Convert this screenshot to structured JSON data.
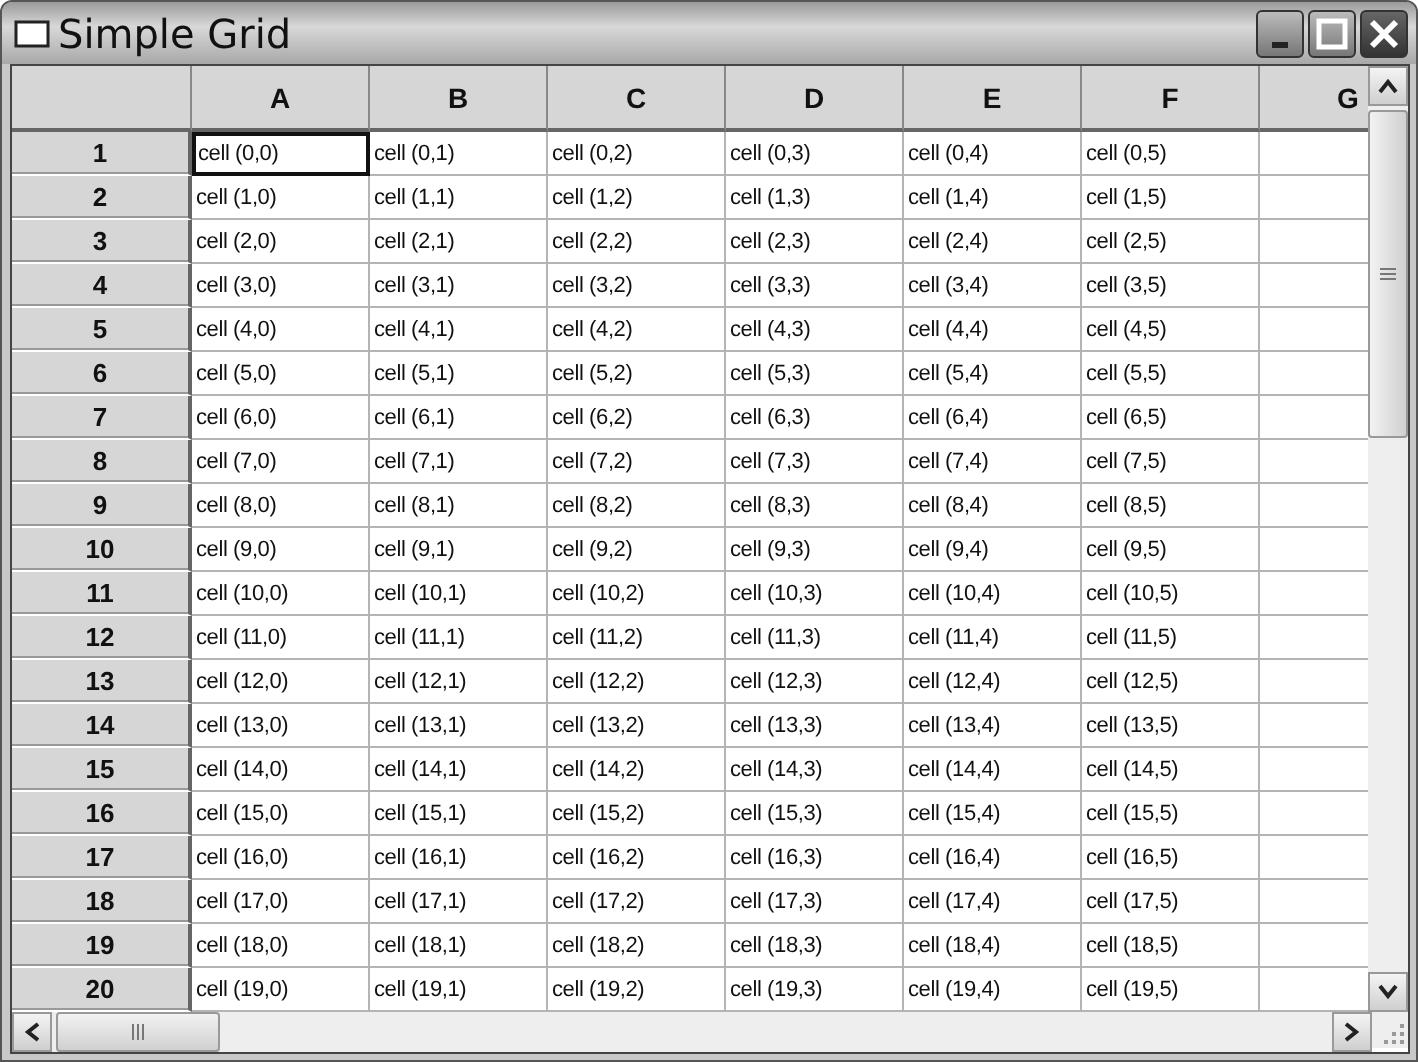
{
  "window": {
    "title": "Simple Grid"
  },
  "grid": {
    "columns": [
      "A",
      "B",
      "C",
      "D",
      "E",
      "F",
      "G"
    ],
    "rows": [
      {
        "header": "1",
        "cells": [
          {
            "text": "cell (0,0)",
            "selected": true
          },
          {
            "text": "cell (0,1)",
            "selected": false
          },
          {
            "text": "cell (0,2)",
            "selected": false
          },
          {
            "text": "cell (0,3)",
            "selected": false
          },
          {
            "text": "cell (0,4)",
            "selected": false
          },
          {
            "text": "cell (0,5)",
            "selected": false
          }
        ]
      },
      {
        "header": "2",
        "cells": [
          {
            "text": "cell (1,0)",
            "selected": false
          },
          {
            "text": "cell (1,1)",
            "selected": false
          },
          {
            "text": "cell (1,2)",
            "selected": false
          },
          {
            "text": "cell (1,3)",
            "selected": false
          },
          {
            "text": "cell (1,4)",
            "selected": false
          },
          {
            "text": "cell (1,5)",
            "selected": false
          }
        ]
      },
      {
        "header": "3",
        "cells": [
          {
            "text": "cell (2,0)",
            "selected": false
          },
          {
            "text": "cell (2,1)",
            "selected": false
          },
          {
            "text": "cell (2,2)",
            "selected": false
          },
          {
            "text": "cell (2,3)",
            "selected": false
          },
          {
            "text": "cell (2,4)",
            "selected": false
          },
          {
            "text": "cell (2,5)",
            "selected": false
          }
        ]
      },
      {
        "header": "4",
        "cells": [
          {
            "text": "cell (3,0)",
            "selected": false
          },
          {
            "text": "cell (3,1)",
            "selected": false
          },
          {
            "text": "cell (3,2)",
            "selected": false
          },
          {
            "text": "cell (3,3)",
            "selected": false
          },
          {
            "text": "cell (3,4)",
            "selected": false
          },
          {
            "text": "cell (3,5)",
            "selected": false
          }
        ]
      },
      {
        "header": "5",
        "cells": [
          {
            "text": "cell (4,0)",
            "selected": false
          },
          {
            "text": "cell (4,1)",
            "selected": false
          },
          {
            "text": "cell (4,2)",
            "selected": false
          },
          {
            "text": "cell (4,3)",
            "selected": false
          },
          {
            "text": "cell (4,4)",
            "selected": false
          },
          {
            "text": "cell (4,5)",
            "selected": false
          }
        ]
      },
      {
        "header": "6",
        "cells": [
          {
            "text": "cell (5,0)",
            "selected": false
          },
          {
            "text": "cell (5,1)",
            "selected": false
          },
          {
            "text": "cell (5,2)",
            "selected": false
          },
          {
            "text": "cell (5,3)",
            "selected": false
          },
          {
            "text": "cell (5,4)",
            "selected": false
          },
          {
            "text": "cell (5,5)",
            "selected": false
          }
        ]
      },
      {
        "header": "7",
        "cells": [
          {
            "text": "cell (6,0)",
            "selected": false
          },
          {
            "text": "cell (6,1)",
            "selected": false
          },
          {
            "text": "cell (6,2)",
            "selected": false
          },
          {
            "text": "cell (6,3)",
            "selected": false
          },
          {
            "text": "cell (6,4)",
            "selected": false
          },
          {
            "text": "cell (6,5)",
            "selected": false
          }
        ]
      },
      {
        "header": "8",
        "cells": [
          {
            "text": "cell (7,0)",
            "selected": false
          },
          {
            "text": "cell (7,1)",
            "selected": false
          },
          {
            "text": "cell (7,2)",
            "selected": false
          },
          {
            "text": "cell (7,3)",
            "selected": false
          },
          {
            "text": "cell (7,4)",
            "selected": false
          },
          {
            "text": "cell (7,5)",
            "selected": false
          }
        ]
      },
      {
        "header": "9",
        "cells": [
          {
            "text": "cell (8,0)",
            "selected": false
          },
          {
            "text": "cell (8,1)",
            "selected": false
          },
          {
            "text": "cell (8,2)",
            "selected": false
          },
          {
            "text": "cell (8,3)",
            "selected": false
          },
          {
            "text": "cell (8,4)",
            "selected": false
          },
          {
            "text": "cell (8,5)",
            "selected": false
          }
        ]
      },
      {
        "header": "10",
        "cells": [
          {
            "text": "cell (9,0)",
            "selected": false
          },
          {
            "text": "cell (9,1)",
            "selected": false
          },
          {
            "text": "cell (9,2)",
            "selected": false
          },
          {
            "text": "cell (9,3)",
            "selected": false
          },
          {
            "text": "cell (9,4)",
            "selected": false
          },
          {
            "text": "cell (9,5)",
            "selected": false
          }
        ]
      },
      {
        "header": "11",
        "cells": [
          {
            "text": "cell (10,0)",
            "selected": false
          },
          {
            "text": "cell (10,1)",
            "selected": false
          },
          {
            "text": "cell (10,2)",
            "selected": false
          },
          {
            "text": "cell (10,3)",
            "selected": false
          },
          {
            "text": "cell (10,4)",
            "selected": false
          },
          {
            "text": "cell (10,5)",
            "selected": false
          }
        ]
      },
      {
        "header": "12",
        "cells": [
          {
            "text": "cell (11,0)",
            "selected": false
          },
          {
            "text": "cell (11,1)",
            "selected": false
          },
          {
            "text": "cell (11,2)",
            "selected": false
          },
          {
            "text": "cell (11,3)",
            "selected": false
          },
          {
            "text": "cell (11,4)",
            "selected": false
          },
          {
            "text": "cell (11,5)",
            "selected": false
          }
        ]
      },
      {
        "header": "13",
        "cells": [
          {
            "text": "cell (12,0)",
            "selected": false
          },
          {
            "text": "cell (12,1)",
            "selected": false
          },
          {
            "text": "cell (12,2)",
            "selected": false
          },
          {
            "text": "cell (12,3)",
            "selected": false
          },
          {
            "text": "cell (12,4)",
            "selected": false
          },
          {
            "text": "cell (12,5)",
            "selected": false
          }
        ]
      },
      {
        "header": "14",
        "cells": [
          {
            "text": "cell (13,0)",
            "selected": false
          },
          {
            "text": "cell (13,1)",
            "selected": false
          },
          {
            "text": "cell (13,2)",
            "selected": false
          },
          {
            "text": "cell (13,3)",
            "selected": false
          },
          {
            "text": "cell (13,4)",
            "selected": false
          },
          {
            "text": "cell (13,5)",
            "selected": false
          }
        ]
      },
      {
        "header": "15",
        "cells": [
          {
            "text": "cell (14,0)",
            "selected": false
          },
          {
            "text": "cell (14,1)",
            "selected": false
          },
          {
            "text": "cell (14,2)",
            "selected": false
          },
          {
            "text": "cell (14,3)",
            "selected": false
          },
          {
            "text": "cell (14,4)",
            "selected": false
          },
          {
            "text": "cell (14,5)",
            "selected": false
          }
        ]
      },
      {
        "header": "16",
        "cells": [
          {
            "text": "cell (15,0)",
            "selected": false
          },
          {
            "text": "cell (15,1)",
            "selected": false
          },
          {
            "text": "cell (15,2)",
            "selected": false
          },
          {
            "text": "cell (15,3)",
            "selected": false
          },
          {
            "text": "cell (15,4)",
            "selected": false
          },
          {
            "text": "cell (15,5)",
            "selected": false
          }
        ]
      },
      {
        "header": "17",
        "cells": [
          {
            "text": "cell (16,0)",
            "selected": false
          },
          {
            "text": "cell (16,1)",
            "selected": false
          },
          {
            "text": "cell (16,2)",
            "selected": false
          },
          {
            "text": "cell (16,3)",
            "selected": false
          },
          {
            "text": "cell (16,4)",
            "selected": false
          },
          {
            "text": "cell (16,5)",
            "selected": false
          }
        ]
      },
      {
        "header": "18",
        "cells": [
          {
            "text": "cell (17,0)",
            "selected": false
          },
          {
            "text": "cell (17,1)",
            "selected": false
          },
          {
            "text": "cell (17,2)",
            "selected": false
          },
          {
            "text": "cell (17,3)",
            "selected": false
          },
          {
            "text": "cell (17,4)",
            "selected": false
          },
          {
            "text": "cell (17,5)",
            "selected": false
          }
        ]
      },
      {
        "header": "19",
        "cells": [
          {
            "text": "cell (18,0)",
            "selected": false
          },
          {
            "text": "cell (18,1)",
            "selected": false
          },
          {
            "text": "cell (18,2)",
            "selected": false
          },
          {
            "text": "cell (18,3)",
            "selected": false
          },
          {
            "text": "cell (18,4)",
            "selected": false
          },
          {
            "text": "cell (18,5)",
            "selected": false
          }
        ]
      },
      {
        "header": "20",
        "cells": [
          {
            "text": "cell (19,0)",
            "selected": false
          },
          {
            "text": "cell (19,1)",
            "selected": false
          },
          {
            "text": "cell (19,2)",
            "selected": false
          },
          {
            "text": "cell (19,3)",
            "selected": false
          },
          {
            "text": "cell (19,4)",
            "selected": false
          },
          {
            "text": "cell (19,5)",
            "selected": false
          }
        ]
      }
    ]
  }
}
